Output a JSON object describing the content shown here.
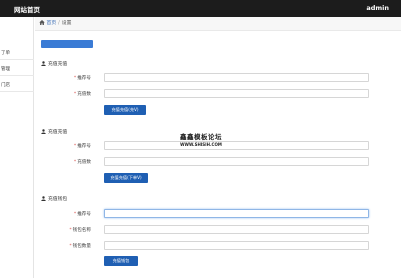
{
  "topbar": {
    "title": "网站首页",
    "user": "admin"
  },
  "sidebar": {
    "items": [
      "了单",
      "管理",
      "门店"
    ]
  },
  "breadcrumb": {
    "home": "首页",
    "separator": "/",
    "current": "设置"
  },
  "top_button": "",
  "sections": [
    {
      "title": "充值充值",
      "fields": [
        {
          "label": "推荐号",
          "value": ""
        },
        {
          "label": "充值数",
          "value": ""
        }
      ],
      "button": "充值充值(充V)"
    },
    {
      "title": "充值充值",
      "fields": [
        {
          "label": "推荐号",
          "value": ""
        },
        {
          "label": "充值数",
          "value": ""
        }
      ],
      "button": "充值充值(下单V)"
    },
    {
      "title": "充值钱包",
      "fields": [
        {
          "label": "推荐号",
          "value": ""
        },
        {
          "label": "钱包名称",
          "value": ""
        },
        {
          "label": "钱包数量",
          "value": ""
        }
      ],
      "button": "充值钱包"
    }
  ],
  "watermark": {
    "cn": "鑫鑫模板论坛",
    "url": "WWW.SHISIH.COM"
  },
  "colors": {
    "topbar": "#1c1c1c",
    "primary_button": "#1f5fb3",
    "accent": "#3a7bd5",
    "required": "#d9534f"
  }
}
